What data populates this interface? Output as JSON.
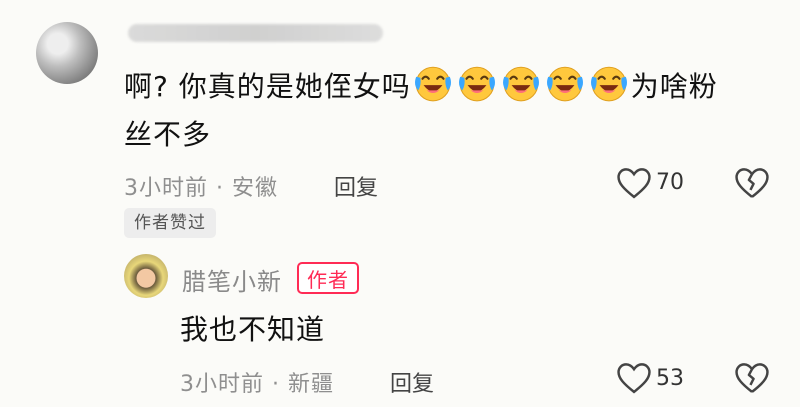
{
  "comment": {
    "username_blurred": "",
    "text_before_emoji": "啊? 你真的是她侄女吗",
    "emoji_name": "laugh-cry-emoji",
    "emoji_count": 5,
    "text_after_emoji": "为啥粉",
    "text_line2": "丝不多",
    "time": "3小时前",
    "location": "安徽",
    "reply_label": "回复",
    "like_count": "70",
    "author_liked_badge": "作者赞过"
  },
  "reply": {
    "username": "腊笔小新",
    "author_tag": "作者",
    "text": "我也不知道",
    "time": "3小时前",
    "location": "新疆",
    "reply_label": "回复",
    "like_count": "53"
  },
  "colors": {
    "background": "#fbfbf8",
    "author_tag": "#ff2b55",
    "meta_gray": "#8f8f8f"
  },
  "icons": [
    "heart-outline-icon",
    "broken-heart-icon"
  ]
}
